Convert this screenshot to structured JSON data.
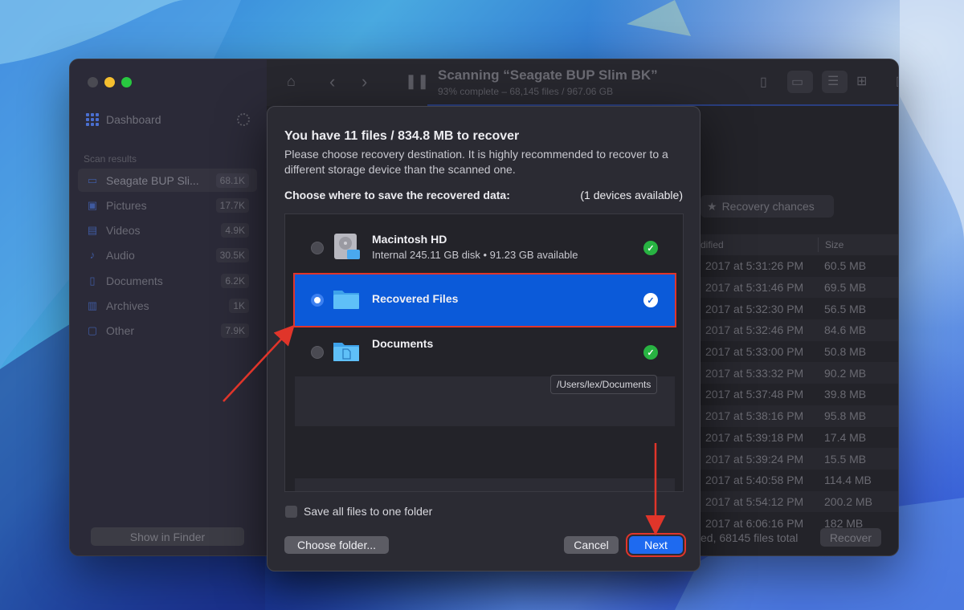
{
  "app": {
    "sidebar": {
      "dashboard_label": "Dashboard",
      "section_label": "Scan results",
      "items": [
        {
          "label": "Seagate BUP Sli...",
          "count": "68.1K",
          "icon": "drive-icon"
        },
        {
          "label": "Pictures",
          "count": "17.7K",
          "icon": "pictures-icon"
        },
        {
          "label": "Videos",
          "count": "4.9K",
          "icon": "videos-icon"
        },
        {
          "label": "Audio",
          "count": "30.5K",
          "icon": "audio-icon"
        },
        {
          "label": "Documents",
          "count": "6.2K",
          "icon": "documents-icon"
        },
        {
          "label": "Archives",
          "count": "1K",
          "icon": "archives-icon"
        },
        {
          "label": "Other",
          "count": "7.9K",
          "icon": "other-icon"
        }
      ],
      "show_in_finder": "Show in Finder"
    },
    "toolbar": {
      "title": "Scanning “Seagate BUP Slim BK”",
      "subtitle": "93% complete – 68,145 files / 967.06 GB"
    },
    "recovery_chances_label": "Recovery chances",
    "table": {
      "col_modified": "dified",
      "col_size": "Size",
      "rows": [
        {
          "date": "2017 at 5:31:26 PM",
          "size": "60.5 MB"
        },
        {
          "date": "2017 at 5:31:46 PM",
          "size": "69.5 MB"
        },
        {
          "date": "2017 at 5:32:30 PM",
          "size": "56.5 MB"
        },
        {
          "date": "2017 at 5:32:46 PM",
          "size": "84.6 MB"
        },
        {
          "date": "2017 at 5:33:00 PM",
          "size": "50.8 MB"
        },
        {
          "date": "2017 at 5:33:32 PM",
          "size": "90.2 MB"
        },
        {
          "date": "2017 at 5:37:48 PM",
          "size": "39.8 MB"
        },
        {
          "date": "2017 at 5:38:16 PM",
          "size": "95.8 MB"
        },
        {
          "date": "2017 at 5:39:18 PM",
          "size": "17.4 MB"
        },
        {
          "date": "2017 at 5:39:24 PM",
          "size": "15.5 MB"
        },
        {
          "date": "2017 at 5:40:58 PM",
          "size": "114.4 MB"
        },
        {
          "date": "2017 at 5:54:12 PM",
          "size": "200.2 MB"
        },
        {
          "date": "2017 at 6:06:16 PM",
          "size": "182 MB"
        }
      ]
    },
    "footer_status": "ed, 68145 files total",
    "recover_button": "Recover"
  },
  "dialog": {
    "title": "You have 11 files / 834.8 MB to recover",
    "description": "Please choose recovery destination. It is highly recommended to recover to a different storage device than the scanned one.",
    "choose_label": "Choose where to save the recovered data:",
    "devices_available": "(1 devices available)",
    "destinations": [
      {
        "name": "Macintosh HD",
        "detail": "Internal 245.11 GB disk • 91.23 GB available",
        "icon": "hard-drive-icon",
        "selected": false
      },
      {
        "name": "Recovered Files",
        "detail": "",
        "icon": "folder-icon",
        "selected": true
      },
      {
        "name": "Documents",
        "detail": "",
        "icon": "documents-folder-icon",
        "selected": false
      }
    ],
    "tooltip": "/Users/lex/Documents",
    "save_all_label": "Save all files to one folder",
    "choose_folder_button": "Choose folder...",
    "cancel_button": "Cancel",
    "next_button": "Next"
  },
  "colors": {
    "accent": "#0b5ad9",
    "highlight_outline": "#e0352a",
    "check_green": "#28b342"
  }
}
